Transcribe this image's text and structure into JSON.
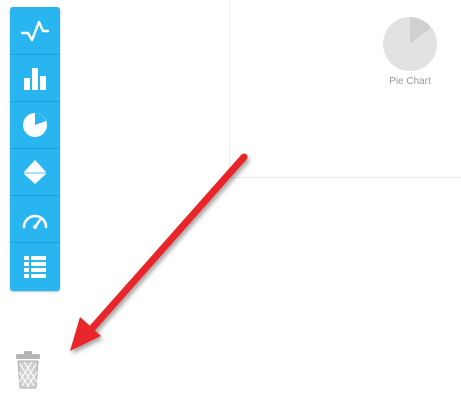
{
  "toolbar": {
    "buttons": [
      {
        "icon": "line-chart-icon"
      },
      {
        "icon": "bar-chart-icon"
      },
      {
        "icon": "pie-chart-icon"
      },
      {
        "icon": "funnel-chart-icon"
      },
      {
        "icon": "gauge-chart-icon"
      },
      {
        "icon": "table-list-icon"
      }
    ],
    "accent_color": "#29b6f0"
  },
  "canvas": {
    "widgets": [
      {
        "label": "Pie Chart",
        "icon": "pie-chart-icon"
      }
    ]
  },
  "trash": {
    "icon": "trash-can-icon"
  },
  "annotation": {
    "icon": "red-arrow-icon",
    "color": "#e8262a"
  }
}
